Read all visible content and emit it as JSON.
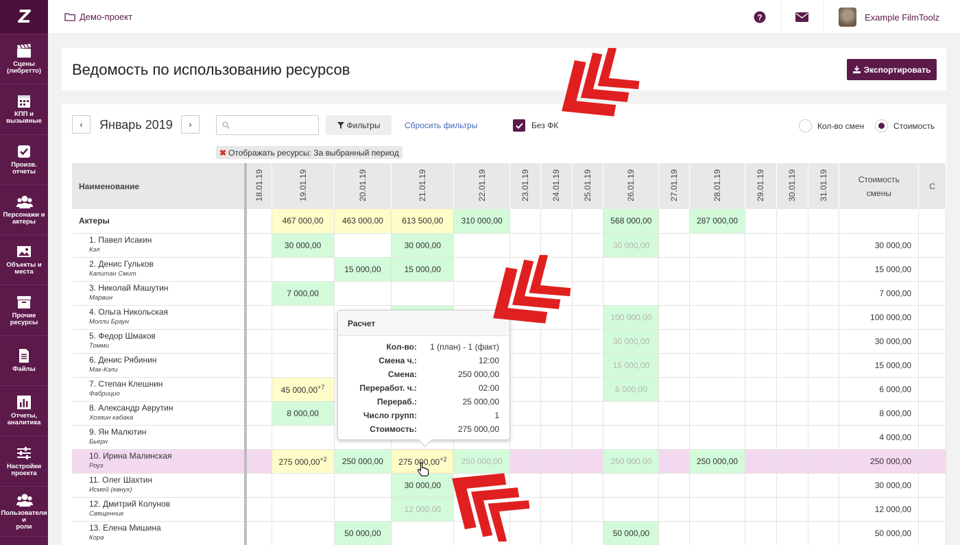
{
  "sidebar": {
    "logo": "Z",
    "items": [
      {
        "label": "Сцены\n(либретто)",
        "icon": "clapperboard-icon"
      },
      {
        "label": "КПП и\nвызывные",
        "icon": "calendar-icon"
      },
      {
        "label": "Произв.\nотчеты",
        "icon": "checkbox-icon"
      },
      {
        "label": "Персонажи и\nактеры",
        "icon": "users-icon"
      },
      {
        "label": "Объекты и\nместа",
        "icon": "image-icon"
      },
      {
        "label": "Прочие\nресурсы",
        "icon": "archive-icon"
      },
      {
        "label": "Файлы",
        "icon": "file-icon"
      },
      {
        "label": "Отчеты,\nаналитика",
        "icon": "chart-icon"
      },
      {
        "label": "Настройки\nпроекта",
        "icon": "sliders-icon"
      },
      {
        "label": "Пользователи и\nроли",
        "icon": "users-icon"
      }
    ]
  },
  "topbar": {
    "breadcrumb": "Демо-проект",
    "user_name": "Example FilmToolz"
  },
  "page": {
    "title": "Ведомость по использованию ресурсов",
    "export_label": "Экспортировать"
  },
  "toolbar": {
    "prev": "‹",
    "next": "›",
    "month": "Январь 2019",
    "search_placeholder": "",
    "filters_label": "Фильтры",
    "reset_label": "Сбросить фильтры",
    "no_fk_label": "Без ФК",
    "radio_shifts": "Кол-во смен",
    "radio_cost": "Стоимость",
    "chip": "Отображать ресурсы: За выбранный период"
  },
  "table": {
    "name_header": "Наименование",
    "dates": [
      "18.01.19",
      "19.01.19",
      "20.01.19",
      "21.01.19",
      "22.01.19",
      "23.01.19",
      "24.01.19",
      "25.01.19",
      "26.01.19",
      "27.01.19",
      "28.01.19",
      "29.01.19",
      "30.01.19",
      "31.01.19"
    ],
    "cost_header_1": "Стоимость",
    "cost_header_2": "смены",
    "extra_header": "С",
    "group": {
      "name": "Актеры",
      "cells": [
        "",
        "467 000,00",
        "463 000,00",
        "613 500,00",
        "310 000,00",
        "",
        "",
        "",
        "568 000,00",
        "",
        "287 000,00",
        "",
        "",
        ""
      ]
    },
    "rows": [
      {
        "name": "1. Павел Исакин",
        "role": "Кэл",
        "cells": [
          "",
          "30 000,00",
          "",
          "30 000,00",
          "",
          "",
          "",
          "",
          "30 000,00",
          "",
          "",
          "",
          "",
          ""
        ],
        "total": "30 000,00"
      },
      {
        "name": "2. Денис Гульков",
        "role": "Капитан Смит",
        "cells": [
          "",
          "",
          "15 000,00",
          "15 000,00",
          "",
          "",
          "",
          "",
          "",
          "",
          "",
          "",
          "",
          ""
        ],
        "total": "15 000,00"
      },
      {
        "name": "3. Николай Машутин",
        "role": "Марвин",
        "cells": [
          "",
          "7 000,00",
          "",
          "",
          "",
          "",
          "",
          "",
          "",
          "",
          "",
          "",
          "",
          ""
        ],
        "total": "7 000,00"
      },
      {
        "name": "4. Ольга Никольская",
        "role": "Молли Браун",
        "cells": [
          "",
          "",
          "",
          "",
          "",
          "",
          "",
          "",
          "100 000,00",
          "",
          "",
          "",
          "",
          ""
        ],
        "total": "100 000,00"
      },
      {
        "name": "5. Федор Шмаков",
        "role": "Томми",
        "cells": [
          "",
          "",
          "",
          "",
          "",
          "",
          "",
          "",
          "30 000,00",
          "",
          "",
          "",
          "",
          ""
        ],
        "total": "30 000,00"
      },
      {
        "name": "6. Денис Рябинин",
        "role": "Мак-Кэли",
        "cells": [
          "",
          "",
          "",
          "",
          "",
          "",
          "",
          "",
          "15 000,00",
          "",
          "",
          "",
          "",
          ""
        ],
        "total": "15 000,00"
      },
      {
        "name": "7. Степан Клешнин",
        "role": "Фабрицио",
        "cells": [
          "",
          "45 000,00",
          "",
          "",
          "",
          "",
          "",
          "",
          "6 000,00",
          "",
          "",
          "",
          "",
          ""
        ],
        "sup1": "+7",
        "total": "6 000,00"
      },
      {
        "name": "8. Александр Аврутин",
        "role": "Хозяин кабака",
        "cells": [
          "",
          "8 000,00",
          "",
          "",
          "",
          "",
          "",
          "",
          "",
          "",
          "",
          "",
          "",
          ""
        ],
        "total": "8 000,00"
      },
      {
        "name": "9. Ян Малютин",
        "role": "Бьерн",
        "cells": [
          "",
          "",
          "",
          "",
          "",
          "",
          "",
          "",
          "",
          "",
          "",
          "",
          "",
          ""
        ],
        "total": "4 000,00"
      },
      {
        "name": "10. Ирина Малинская",
        "role": "Роуз",
        "cells": [
          "",
          "275 000,00",
          "250 000,00",
          "275 000,00",
          "250 000,00",
          "",
          "",
          "",
          "250 000,00",
          "",
          "250 000,00",
          "",
          "",
          ""
        ],
        "sup1": "+2",
        "sup3": "+2",
        "total": "250 000,00"
      },
      {
        "name": "11. Олег Шахтин",
        "role": "Исмей (евнух)",
        "cells": [
          "",
          "",
          "",
          "30 000,00",
          "",
          "",
          "",
          "",
          "",
          "",
          "",
          "",
          "",
          ""
        ],
        "total": "30 000,00"
      },
      {
        "name": "12. Дмитрий Колунов",
        "role": "Священник",
        "cells": [
          "",
          "",
          "",
          "12 000,00",
          "",
          "",
          "",
          "",
          "",
          "",
          "",
          "",
          "",
          ""
        ],
        "total": "12 000,00"
      },
      {
        "name": "13. Елена Мишина",
        "role": "Кора",
        "cells": [
          "",
          "",
          "50 000,00",
          "",
          "",
          "",
          "",
          "",
          "50 000,00",
          "",
          "",
          "",
          "",
          ""
        ],
        "total": "50 000,00"
      }
    ]
  },
  "popup": {
    "title": "Расчет",
    "rows": [
      {
        "k": "Кол-во:",
        "v": "1 (план) - 1 (факт)"
      },
      {
        "k": "Смена ч.:",
        "v": "12:00"
      },
      {
        "k": "Смена:",
        "v": "250 000,00"
      },
      {
        "k": "Переработ. ч.:",
        "v": "02:00"
      },
      {
        "k": "Перераб.:",
        "v": "25 000,00"
      },
      {
        "k": "Число групп:",
        "v": "1"
      },
      {
        "k": "Стоимость:",
        "v": "275 000,00"
      }
    ]
  },
  "colors": {
    "brand": "#5c1a4b",
    "green_cell": "#d3fbd9",
    "yellow_cell": "#fefcc8",
    "highlight_row": "#f3d9ef",
    "annotation_red": "#e02020"
  }
}
